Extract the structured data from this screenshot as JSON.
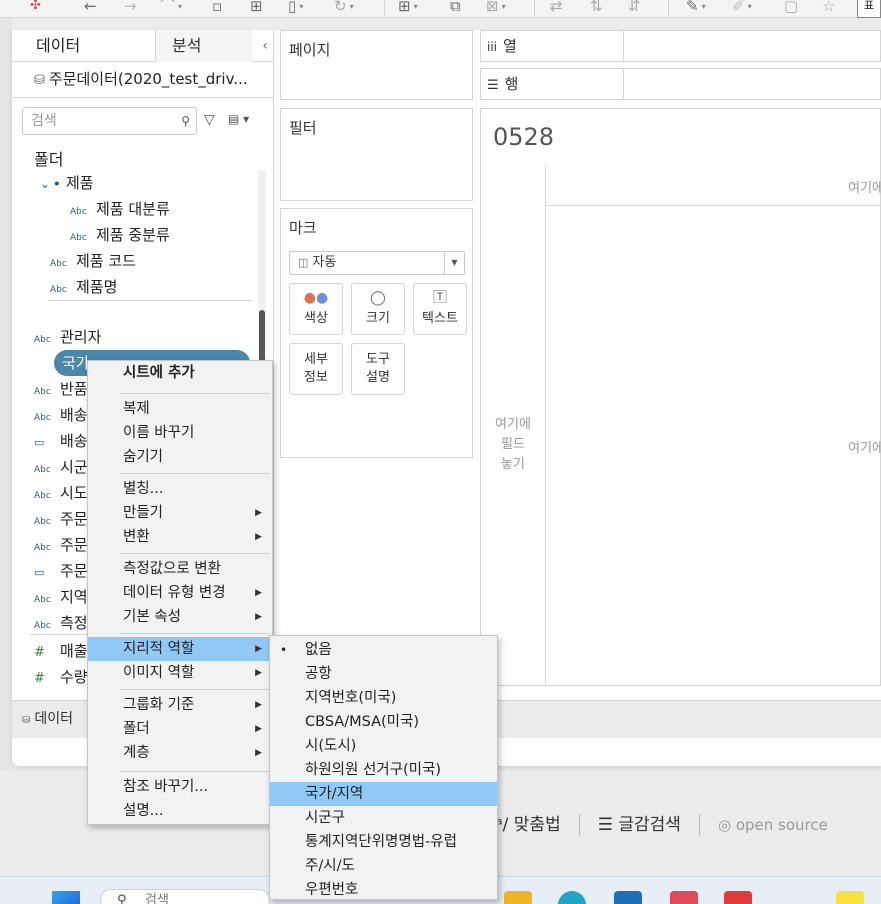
{
  "toolbar": {
    "left_label": "데",
    "right_box": "표",
    "icons": [
      "tableau-logo-icon",
      "back-icon",
      "forward-icon",
      "undo-icon",
      "save-icon",
      "add-datasource-icon",
      "new-sheet-icon",
      "refresh-icon",
      "new-worksheet-icon",
      "duplicate-icon",
      "clear-icon",
      "swap-icon",
      "sort-asc-icon",
      "sort-desc-icon",
      "highlight-icon",
      "pen-icon",
      "annotate-icon",
      "pin-icon"
    ]
  },
  "datapane": {
    "tab_data": "데이터",
    "tab_analysis": "분석",
    "collapse": "‹",
    "datasource": "주문데이터(2020_test_driv...",
    "search_placeholder": "검색",
    "folder_header": "폴더",
    "fields": [
      {
        "type": "hierarchy",
        "icon": "⌄ ꔷ",
        "label": "제품"
      },
      {
        "type": "string",
        "icon": "Abc",
        "label": "제품 대분류"
      },
      {
        "type": "string",
        "icon": "Abc",
        "label": "제품 중분류"
      },
      {
        "type": "string",
        "icon": "Abc",
        "label": "제품 코드"
      },
      {
        "type": "string",
        "icon": "Abc",
        "label": "제품명"
      },
      {
        "type": "string",
        "icon": "Abc",
        "label": "관리자"
      },
      {
        "type": "string",
        "icon": "Abc",
        "label": "국가"
      },
      {
        "type": "string",
        "icon": "Abc",
        "label": "반품"
      },
      {
        "type": "string",
        "icon": "Abc",
        "label": "배송"
      },
      {
        "type": "date",
        "icon": "▭",
        "label": "배송"
      },
      {
        "type": "string",
        "icon": "Abc",
        "label": "시군"
      },
      {
        "type": "string",
        "icon": "Abc",
        "label": "시도"
      },
      {
        "type": "string",
        "icon": "Abc",
        "label": "주문"
      },
      {
        "type": "string",
        "icon": "Abc",
        "label": "주문"
      },
      {
        "type": "date",
        "icon": "▭",
        "label": "주문"
      },
      {
        "type": "string",
        "icon": "Abc",
        "label": "지역"
      },
      {
        "type": "string",
        "icon": "Abc",
        "label": "측정"
      },
      {
        "type": "number",
        "icon": "#",
        "label": "매출"
      },
      {
        "type": "number",
        "icon": "#",
        "label": "수량"
      }
    ],
    "datasource_tab": "데이터"
  },
  "shelves": {
    "pages": "페이지",
    "filters": "필터",
    "marks": "마크",
    "mark_type": "자동",
    "mark_cards": [
      {
        "label": "색상",
        "icon": "●●"
      },
      {
        "label": "크기",
        "icon": "◯"
      },
      {
        "label": "텍스트",
        "icon": "T"
      },
      {
        "label": "세부\n정보",
        "icon": ""
      },
      {
        "label": "도구\n설명",
        "icon": ""
      }
    ],
    "columns": "열",
    "rows": "행"
  },
  "view": {
    "title": "0528",
    "drop_top": "여기에",
    "drop_mid": "여기에",
    "drop_left": "여기에\n필드\n놓기"
  },
  "context_menu": {
    "items": [
      {
        "label": "시트에 추가",
        "bold": true
      },
      {
        "label": "복제"
      },
      {
        "label": "이름 바꾸기"
      },
      {
        "label": "숨기기"
      },
      {
        "label": "별칭..."
      },
      {
        "label": "만들기",
        "submenu": true
      },
      {
        "label": "변환",
        "submenu": true
      },
      {
        "label": "측정값으로 변환"
      },
      {
        "label": "데이터 유형 변경",
        "submenu": true
      },
      {
        "label": "기본 속성",
        "submenu": true
      },
      {
        "label": "지리적 역할",
        "submenu": true,
        "highlighted": true
      },
      {
        "label": "이미지 역할",
        "submenu": true
      },
      {
        "label": "그룹화 기준",
        "submenu": true
      },
      {
        "label": "폴더",
        "submenu": true
      },
      {
        "label": "계층",
        "submenu": true
      },
      {
        "label": "참조 바꾸기..."
      },
      {
        "label": "설명..."
      }
    ]
  },
  "geo_submenu": {
    "items": [
      {
        "label": "없음",
        "checked": true
      },
      {
        "label": "공항"
      },
      {
        "label": "지역번호(미국)"
      },
      {
        "label": "CBSA/MSA(미국)"
      },
      {
        "label": "시(도시)"
      },
      {
        "label": "하원의원 선거구(미국)"
      },
      {
        "label": "국가/지역",
        "highlighted": true
      },
      {
        "label": "시군구"
      },
      {
        "label": "통계지역단위명명법-유럽"
      },
      {
        "label": "주/시/도"
      },
      {
        "label": "우편번호"
      }
    ]
  },
  "background_app": {
    "items": [
      "맞춤법",
      "글감검색",
      "open source"
    ]
  },
  "taskbar": {
    "search_placeholder": "검색"
  },
  "colors": {
    "highlight": "#90c8f6",
    "pill": "#4a87a8",
    "string_icon": "#1f5e8a",
    "number_icon": "#2d8a4a"
  }
}
